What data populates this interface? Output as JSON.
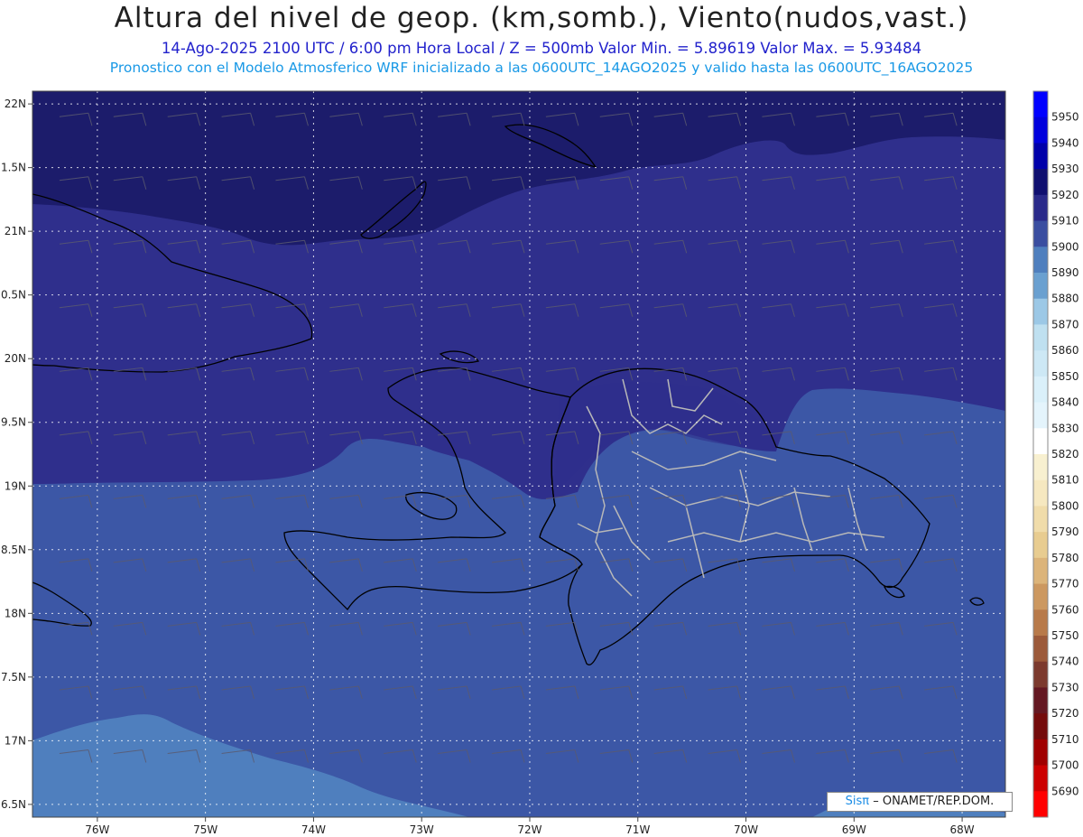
{
  "title": "Altura del nivel de geop. (km,somb.), Viento(nudos,vast.)",
  "subtitle_line1": "14-Ago-2025  2100 UTC / 6:00 pm Hora Local / Z = 500mb     Valor Min. = 5.89619  Valor Max. = 5.93484",
  "subtitle_line2": "Pronostico con el Modelo Atmosferico WRF inicializado a las 0600UTC_14AGO2025 y valido hasta las  0600UTC_16AGO2025",
  "credit": {
    "logo": "Sisπ",
    "text": "– ONAMET/REP.DOM."
  },
  "map": {
    "lon_range": [
      -76.6,
      -67.6
    ],
    "lat_range": [
      16.4,
      22.1
    ],
    "lon_ticks": [
      {
        "value": -76,
        "label": "76W"
      },
      {
        "value": -75,
        "label": "75W"
      },
      {
        "value": -74,
        "label": "74W"
      },
      {
        "value": -73,
        "label": "73W"
      },
      {
        "value": -72,
        "label": "72W"
      },
      {
        "value": -71,
        "label": "71W"
      },
      {
        "value": -70,
        "label": "70W"
      },
      {
        "value": -69,
        "label": "69W"
      },
      {
        "value": -68,
        "label": "68W"
      }
    ],
    "lat_ticks": [
      {
        "value": 22.0,
        "label": "22N"
      },
      {
        "value": 21.5,
        "label": "1.5N"
      },
      {
        "value": 21.0,
        "label": "21N"
      },
      {
        "value": 20.5,
        "label": "0.5N"
      },
      {
        "value": 20.0,
        "label": "20N"
      },
      {
        "value": 19.5,
        "label": "9.5N"
      },
      {
        "value": 19.0,
        "label": "19N"
      },
      {
        "value": 18.5,
        "label": "8.5N"
      },
      {
        "value": 18.0,
        "label": "18N"
      },
      {
        "value": 17.5,
        "label": "7.5N"
      },
      {
        "value": 17.0,
        "label": "17N"
      },
      {
        "value": 16.5,
        "label": "6.5N"
      }
    ],
    "grid": "dotted white",
    "shading_colors": {
      "5920_5930": "#1c1c6b",
      "5910_5920": "#2f2f8c",
      "5900_5910": "#3c57a6",
      "5890_5900": "#4f7fbe"
    }
  },
  "colorbar": {
    "levels": [
      5950,
      5940,
      5930,
      5920,
      5910,
      5900,
      5890,
      5880,
      5870,
      5860,
      5850,
      5840,
      5830,
      5820,
      5810,
      5800,
      5790,
      5780,
      5770,
      5760,
      5750,
      5740,
      5730,
      5720,
      5710,
      5700,
      5690
    ],
    "colors": [
      "#0000ff",
      "#0000dd",
      "#0000aa",
      "#101070",
      "#2a2a8a",
      "#3a4ea0",
      "#4f7fbe",
      "#6aa0d0",
      "#9cc8e6",
      "#bfe0f0",
      "#cde8f5",
      "#daf0fa",
      "#e4f4fc",
      "#ffffff",
      "#f8f0d0",
      "#f6e8c0",
      "#f0dcaa",
      "#e8cc90",
      "#dcb47a",
      "#cc9860",
      "#b87a4a",
      "#9c5a3a",
      "#7c3a2e",
      "#641822",
      "#740c0c",
      "#a00000",
      "#cc0000",
      "#ff0000"
    ]
  }
}
